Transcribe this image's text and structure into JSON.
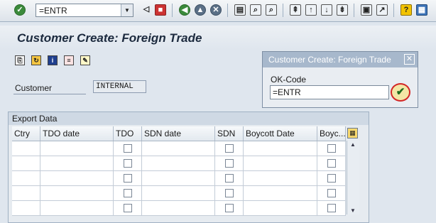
{
  "command_field": {
    "value": "=ENTR"
  },
  "toolbar_icons": [
    "enter-icon",
    "dropdown-icon",
    "back-nav-icon",
    "save-icon",
    "back-icon",
    "exit-icon",
    "cancel-icon",
    "print-icon",
    "find-icon",
    "find-next-icon",
    "first-page-icon",
    "previous-page-icon",
    "next-page-icon",
    "last-page-icon",
    "create-session-icon",
    "shortcut-icon",
    "help-icon",
    "customize-layout-icon"
  ],
  "page": {
    "title": "Customer Create: Foreign Trade"
  },
  "app_toolbar": [
    "document-icon",
    "refresh-icon",
    "info-icon",
    "export-icon",
    "note-icon"
  ],
  "customer": {
    "label": "Customer",
    "value": "INTERNAL"
  },
  "export": {
    "group_title": "Export Data",
    "columns": [
      "Ctry",
      "TDO date",
      "TDO",
      "SDN date",
      "SDN",
      "Boycott Date",
      "Boyc..."
    ],
    "rows": [
      {},
      {},
      {},
      {},
      {}
    ]
  },
  "popup": {
    "title": "Customer Create: Foreign Trade",
    "ok_label": "OK-Code",
    "ok_value": "=ENTR",
    "close_symbol": "✕",
    "confirm_symbol": "✔"
  },
  "colors": {
    "accent_highlight": "#d32626",
    "title_bar": "#a7b8cc",
    "confirm": "#1e6b1e"
  }
}
